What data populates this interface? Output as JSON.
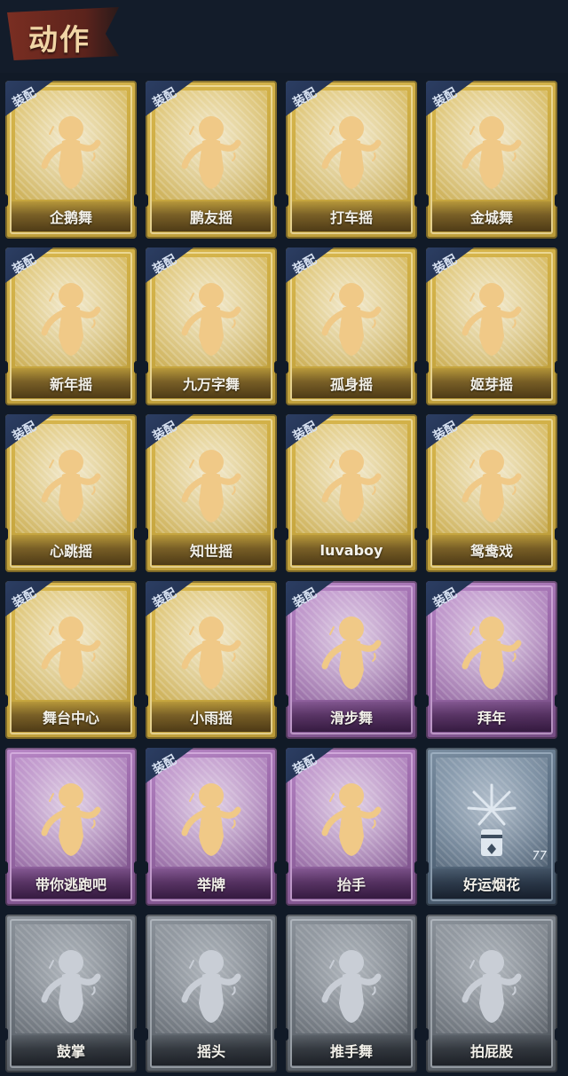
{
  "header": {
    "title": "动作"
  },
  "equip_label": "装配",
  "colors": {
    "gold": "#cfae45",
    "purple": "#9c6bab",
    "blue": "#5e7286",
    "gray": "#6c737b",
    "title_tab": "#7a2e22",
    "background": "#111a27"
  },
  "cards": [
    {
      "label": "企鹅舞",
      "tier": "gold",
      "equipped": true,
      "icon": "penguin-dance-figure-icon"
    },
    {
      "label": "鹏友摇",
      "tier": "gold",
      "equipped": true,
      "icon": "friend-shake-figure-icon"
    },
    {
      "label": "打车摇",
      "tier": "gold",
      "equipped": true,
      "icon": "taxi-shake-figure-icon"
    },
    {
      "label": "金城舞",
      "tier": "gold",
      "equipped": true,
      "icon": "golden-city-dance-figure-icon"
    },
    {
      "label": "新年摇",
      "tier": "gold",
      "equipped": true,
      "icon": "new-year-shake-figure-icon"
    },
    {
      "label": "九万字舞",
      "tier": "gold",
      "equipped": true,
      "icon": "ninety-thousand-words-dance-figure-icon"
    },
    {
      "label": "孤身摇",
      "tier": "gold",
      "equipped": true,
      "icon": "alone-shake-figure-icon"
    },
    {
      "label": "姬芽摇",
      "tier": "gold",
      "equipped": true,
      "icon": "jiya-shake-figure-icon"
    },
    {
      "label": "心跳摇",
      "tier": "gold",
      "equipped": true,
      "icon": "heartbeat-shake-figure-icon"
    },
    {
      "label": "知世摇",
      "tier": "gold",
      "equipped": true,
      "icon": "zhishi-shake-figure-icon"
    },
    {
      "label": "luvaboy",
      "tier": "gold",
      "equipped": true,
      "icon": "luvaboy-figure-icon"
    },
    {
      "label": "鸳鸯戏",
      "tier": "gold",
      "equipped": true,
      "icon": "mandarin-duck-play-figure-icon"
    },
    {
      "label": "舞台中心",
      "tier": "gold",
      "equipped": true,
      "icon": "center-stage-figure-icon"
    },
    {
      "label": "小雨摇",
      "tier": "gold",
      "equipped": true,
      "icon": "light-rain-shake-figure-icon"
    },
    {
      "label": "滑步舞",
      "tier": "purple",
      "equipped": true,
      "icon": "slide-step-dance-figure-icon"
    },
    {
      "label": "拜年",
      "tier": "purple",
      "equipped": true,
      "icon": "new-year-greeting-figure-icon"
    },
    {
      "label": "带你逃跑吧",
      "tier": "purple",
      "equipped": false,
      "icon": "run-away-figure-icon"
    },
    {
      "label": "举牌",
      "tier": "purple",
      "equipped": true,
      "icon": "hold-sign-figure-icon"
    },
    {
      "label": "抬手",
      "tier": "purple",
      "equipped": true,
      "icon": "raise-hand-figure-icon"
    },
    {
      "label": "好运烟花",
      "tier": "blue",
      "equipped": false,
      "icon": "firework-icon",
      "count": "77"
    },
    {
      "label": "鼓掌",
      "tier": "gray",
      "equipped": false,
      "icon": "clap-figure-icon"
    },
    {
      "label": "摇头",
      "tier": "gray",
      "equipped": false,
      "icon": "shake-head-figure-icon"
    },
    {
      "label": "推手舞",
      "tier": "gray",
      "equipped": false,
      "icon": "push-hand-dance-figure-icon"
    },
    {
      "label": "拍屁股",
      "tier": "gray",
      "equipped": false,
      "icon": "pat-butt-figure-icon"
    }
  ]
}
